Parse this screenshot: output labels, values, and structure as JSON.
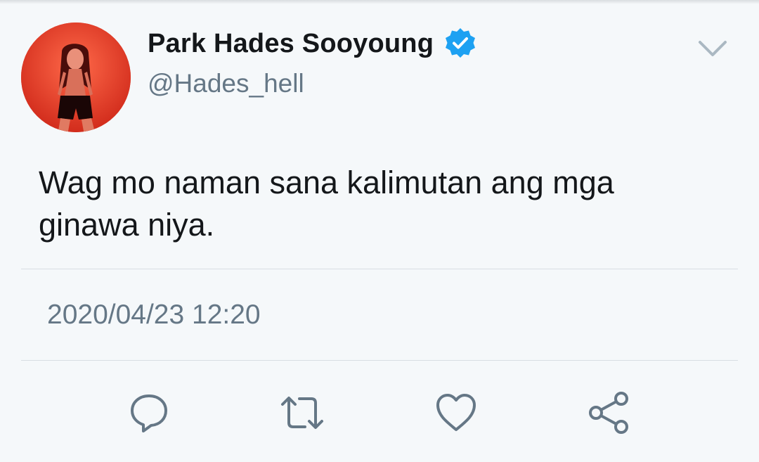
{
  "tweet": {
    "author": {
      "display_name": "Park Hades Sooyoung",
      "handle": "@Hades_hell",
      "verified": true,
      "verified_icon": "verified-badge-icon",
      "avatar": "profile-photo"
    },
    "text_lines": [
      "Wag mo naman sana kalimutan ang mga",
      "ginawa niya."
    ],
    "timestamp": "2020/04/23 12:20"
  },
  "actions": [
    {
      "name": "reply",
      "icon": "reply-icon"
    },
    {
      "name": "retweet",
      "icon": "retweet-icon"
    },
    {
      "name": "like",
      "icon": "heart-icon"
    },
    {
      "name": "share",
      "icon": "share-icon"
    }
  ],
  "colors": {
    "background": "#f5f8fa",
    "text_primary": "#14171a",
    "text_secondary": "#657786",
    "verified_blue": "#1da1f2",
    "icon_gray": "#657786",
    "divider": "#d8dee3"
  }
}
